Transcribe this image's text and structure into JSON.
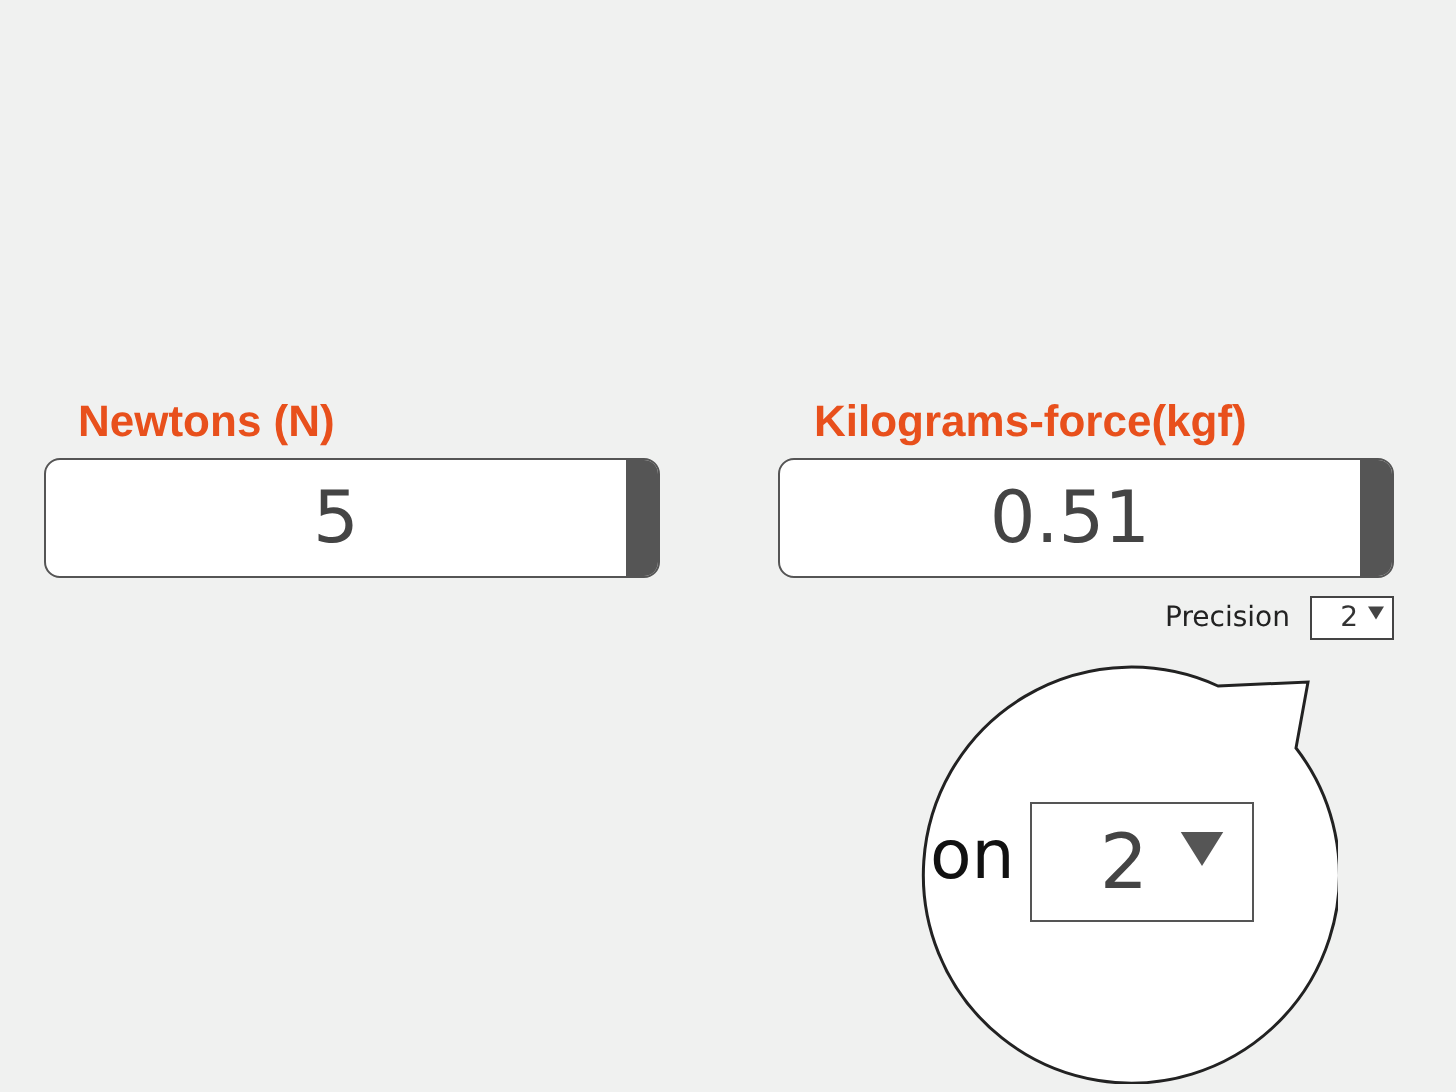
{
  "converters": [
    {
      "label": "Newtons (N)",
      "value": "5"
    },
    {
      "label": "Kilograms-force(kgf)",
      "value": "0.51"
    }
  ],
  "precision": {
    "label": "Precision",
    "value": "2"
  },
  "magnifier": {
    "label_fragment": "on",
    "value": "2"
  }
}
